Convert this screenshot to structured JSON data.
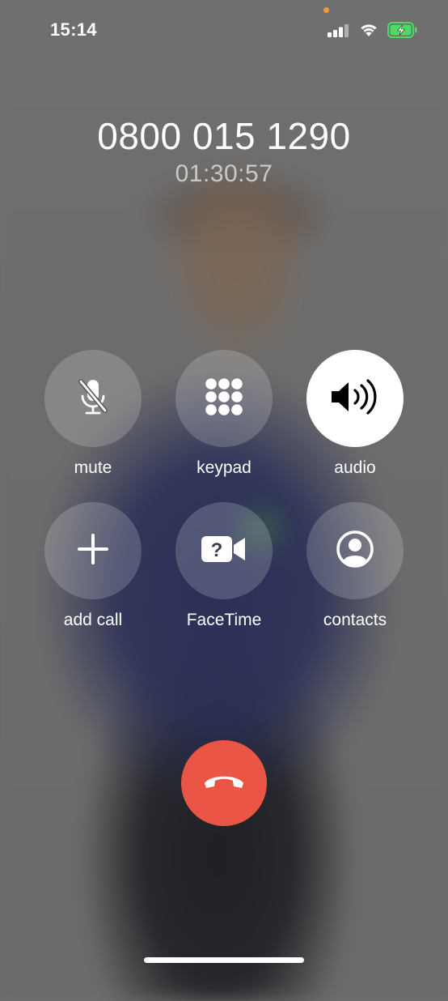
{
  "status_bar": {
    "time": "15:14",
    "recording_dot_color": "#f09a37",
    "signal_icon": "cellular-signal-icon",
    "wifi_icon": "wifi-icon",
    "battery_icon": "battery-charging-icon",
    "battery_color": "#4cd964"
  },
  "call": {
    "number": "0800 015 1290",
    "duration": "01:30:57"
  },
  "controls": {
    "mute": {
      "label": "mute",
      "icon": "microphone-muted-icon",
      "active": false
    },
    "keypad": {
      "label": "keypad",
      "icon": "keypad-grid-icon",
      "active": false
    },
    "audio": {
      "label": "audio",
      "icon": "speaker-icon",
      "active": true
    },
    "add_call": {
      "label": "add call",
      "icon": "plus-icon",
      "active": false
    },
    "facetime": {
      "label": "FaceTime",
      "icon": "facetime-video-question-icon",
      "active": false
    },
    "contacts": {
      "label": "contacts",
      "icon": "person-circle-icon",
      "active": false
    }
  },
  "end_call": {
    "icon": "end-call-phone-icon",
    "color": "#eb5545"
  }
}
